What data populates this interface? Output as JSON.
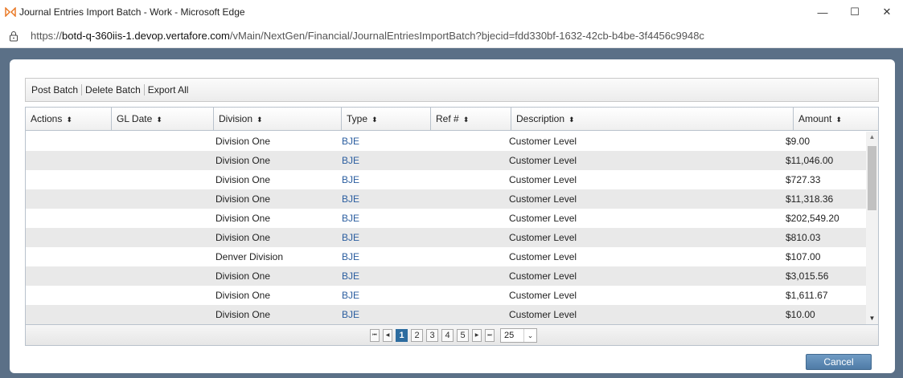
{
  "window": {
    "title": "Journal Entries Import Batch - Work - Microsoft Edge",
    "minimize": "—",
    "maximize": "☐",
    "close": "✕"
  },
  "address": {
    "prefix": "https://",
    "host": "botd-q-360iis-1.devop.vertafore.com",
    "path": "/vMain/NextGen/Financial/JournalEntriesImportBatch?bjecid=fdd330bf-1632-42cb-b4be-3f4456c9948c"
  },
  "toolbar": {
    "post_batch": "Post Batch",
    "delete_batch": "Delete Batch",
    "export_all": "Export All"
  },
  "grid": {
    "columns": [
      {
        "label": "Actions",
        "sort": "⬍"
      },
      {
        "label": "GL Date",
        "sort": "⬍"
      },
      {
        "label": "Division",
        "sort": "⬍"
      },
      {
        "label": "Type",
        "sort": "⬍"
      },
      {
        "label": "Ref #",
        "sort": "⬍"
      },
      {
        "label": "Description",
        "sort": "⬍"
      },
      {
        "label": "Amount",
        "sort": "⬍"
      }
    ],
    "rows": [
      {
        "actions": "",
        "gl_date": "",
        "division": "Division One",
        "type": "BJE",
        "ref": "",
        "description": "Customer Level",
        "amount": "$9.00"
      },
      {
        "actions": "",
        "gl_date": "",
        "division": "Division One",
        "type": "BJE",
        "ref": "",
        "description": "Customer Level",
        "amount": "$11,046.00"
      },
      {
        "actions": "",
        "gl_date": "",
        "division": "Division One",
        "type": "BJE",
        "ref": "",
        "description": "Customer Level",
        "amount": "$727.33"
      },
      {
        "actions": "",
        "gl_date": "",
        "division": "Division One",
        "type": "BJE",
        "ref": "",
        "description": "Customer Level",
        "amount": "$11,318.36"
      },
      {
        "actions": "",
        "gl_date": "",
        "division": "Division One",
        "type": "BJE",
        "ref": "",
        "description": "Customer Level",
        "amount": "$202,549.20"
      },
      {
        "actions": "",
        "gl_date": "",
        "division": "Division One",
        "type": "BJE",
        "ref": "",
        "description": "Customer Level",
        "amount": "$810.03"
      },
      {
        "actions": "",
        "gl_date": "",
        "division": "Denver Division",
        "type": "BJE",
        "ref": "",
        "description": "Customer Level",
        "amount": "$107.00"
      },
      {
        "actions": "",
        "gl_date": "",
        "division": "Division One",
        "type": "BJE",
        "ref": "",
        "description": "Customer Level",
        "amount": "$3,015.56"
      },
      {
        "actions": "",
        "gl_date": "",
        "division": "Division One",
        "type": "BJE",
        "ref": "",
        "description": "Customer Level",
        "amount": "$1,611.67"
      },
      {
        "actions": "",
        "gl_date": "",
        "division": "Division One",
        "type": "BJE",
        "ref": "",
        "description": "Customer Level",
        "amount": "$10.00"
      }
    ]
  },
  "pager": {
    "first": "⏮",
    "prev": "◀",
    "next": "▶",
    "last": "⏭",
    "pages": [
      "1",
      "2",
      "3",
      "4",
      "5"
    ],
    "current_page": "1",
    "page_size": "25",
    "page_size_chevron": "⌄"
  },
  "footer": {
    "cancel": "Cancel"
  },
  "colors": {
    "accent": "#2d6c9f",
    "link": "#2a5d9f",
    "backdrop": "#5b7087"
  },
  "icons": {
    "browser_logo": "edge-logo-icon",
    "lock": "lock-icon"
  }
}
